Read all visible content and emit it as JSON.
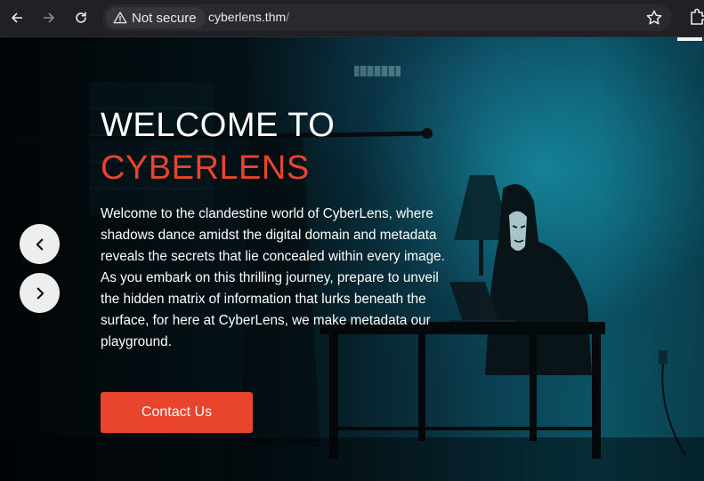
{
  "browser": {
    "security_label": "Not secure",
    "url_host": "cyberlens.thm",
    "url_path": "/"
  },
  "hero": {
    "title_line1": "WELCOME TO",
    "title_line2": "CYBERLENS",
    "description": "Welcome to the clandestine world of CyberLens, where shadows dance amidst the digital domain and metadata reveals the secrets that lie concealed within every image. As you embark on this thrilling journey, prepare to unveil the hidden matrix of information that lurks beneath the surface, for here at CyberLens, we make metadata our playground.",
    "cta_label": "Contact Us"
  },
  "colors": {
    "accent": "#e8452c",
    "browser_bg": "#202124",
    "text": "#ffffff"
  },
  "icons": {
    "back": "arrow-left-icon",
    "forward": "arrow-right-icon",
    "reload": "reload-icon",
    "warning": "warning-triangle-icon",
    "bookmark": "star-icon",
    "extensions": "puzzle-icon",
    "carousel_prev": "chevron-left-icon",
    "carousel_next": "chevron-right-icon"
  }
}
